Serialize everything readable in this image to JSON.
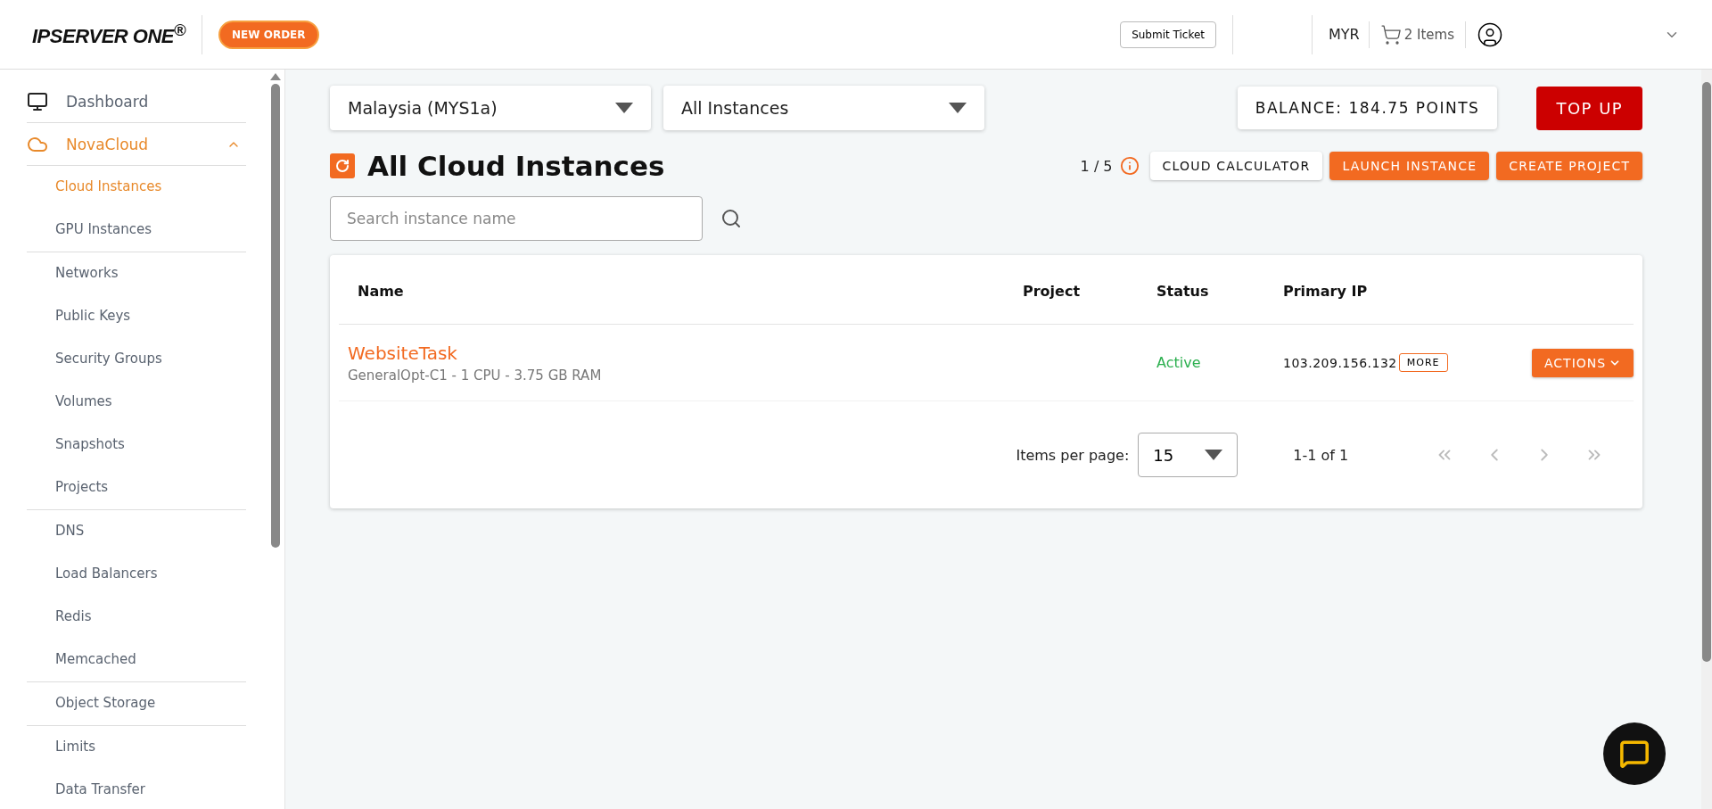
{
  "header": {
    "logo": "IPSERVER ONE",
    "logo_mark": "®",
    "new_order": "NEW ORDER",
    "submit_ticket": "Submit Ticket",
    "currency": "MYR",
    "cart": "2 Items"
  },
  "sidebar": {
    "items": [
      {
        "label": "Dashboard",
        "kind": "top",
        "selected": false
      },
      {
        "label": "NovaCloud",
        "kind": "section",
        "selected": true,
        "expanded": true,
        "groups": [
          [
            {
              "label": "Cloud Instances",
              "selected": true
            },
            {
              "label": "GPU Instances",
              "selected": false
            }
          ],
          [
            {
              "label": "Networks",
              "selected": false
            },
            {
              "label": "Public Keys",
              "selected": false
            },
            {
              "label": "Security Groups",
              "selected": false
            },
            {
              "label": "Volumes",
              "selected": false
            },
            {
              "label": "Snapshots",
              "selected": false
            },
            {
              "label": "Projects",
              "selected": false
            }
          ],
          [
            {
              "label": "DNS",
              "selected": false
            },
            {
              "label": "Load Balancers",
              "selected": false
            },
            {
              "label": "Redis",
              "selected": false
            },
            {
              "label": "Memcached",
              "selected": false
            }
          ],
          [
            {
              "label": "Object Storage",
              "selected": false
            }
          ],
          [
            {
              "label": "Limits",
              "selected": false
            },
            {
              "label": "Data Transfer",
              "selected": false
            }
          ]
        ]
      }
    ]
  },
  "filters": {
    "region": "Malaysia (MYS1a)",
    "scope": "All Instances"
  },
  "balance": "BALANCE: 184.75 POINTS",
  "top_up": "TOP UP",
  "title": "All Cloud Instances",
  "quota": "1 / 5",
  "actions": [
    "CLOUD CALCULATOR",
    "LAUNCH INSTANCE",
    "CREATE PROJECT"
  ],
  "search": {
    "placeholder": "Search instance name"
  },
  "table": {
    "columns": [
      "Name",
      "Project",
      "Status",
      "Primary IP"
    ],
    "rows": [
      {
        "name": "WebsiteTask",
        "spec": "GeneralOpt-C1 - 1 CPU - 3.75 GB RAM",
        "project": "",
        "status": "Active",
        "ip": "103.209.156.132",
        "more": "MORE",
        "actions": "ACTIONS"
      }
    ]
  },
  "pagination": {
    "label": "Items per page:",
    "per_page": "15",
    "range": "1-1 of 1"
  }
}
